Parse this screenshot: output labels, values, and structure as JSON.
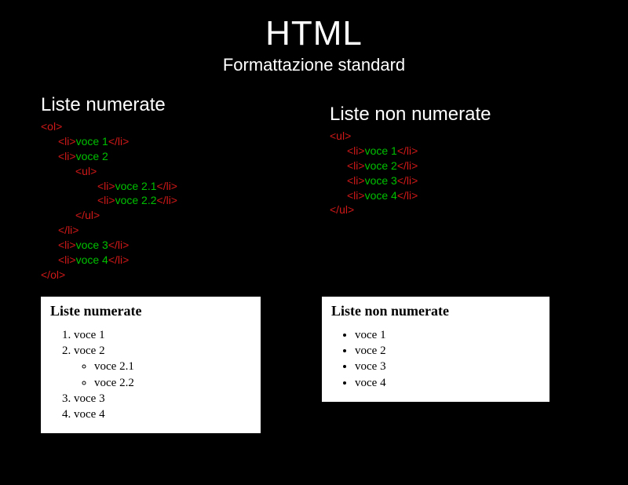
{
  "title": "HTML",
  "subtitle": "Formattazione standard",
  "left": {
    "heading": "Liste numerate",
    "code": {
      "open_ol": "<ol>",
      "li_open": "<li>",
      "li_close": "</li>",
      "voce1": "voce 1",
      "voce2": "voce 2",
      "ul_open": "<ul>",
      "voce21": "voce 2.1",
      "voce22": "voce 2.2",
      "ul_close": "</ul>",
      "li_close_solo": "</li>",
      "voce3": "voce 3",
      "voce4": "voce 4",
      "close_ol": "</ol>"
    },
    "preview": {
      "title": "Liste numerate",
      "items": [
        "voce 1",
        "voce 2",
        "voce 3",
        "voce 4"
      ],
      "subitems": [
        "voce 2.1",
        "voce 2.2"
      ]
    }
  },
  "right": {
    "heading": "Liste non numerate",
    "code": {
      "open_ul": "<ul>",
      "li_open": "<li>",
      "li_close": "</li>",
      "voce1": "voce 1",
      "voce2": "voce 2",
      "voce3": "voce 3",
      "voce4": "voce 4",
      "close_ul": "</ul>"
    },
    "preview": {
      "title": "Liste non numerate",
      "items": [
        "voce 1",
        "voce 2",
        "voce 3",
        "voce 4"
      ]
    }
  }
}
